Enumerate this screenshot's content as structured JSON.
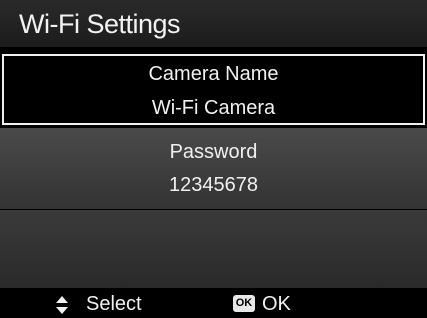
{
  "title": "Wi-Fi Settings",
  "items": [
    {
      "label": "Camera Name",
      "value": "Wi-Fi Camera",
      "selected": true
    },
    {
      "label": "Password",
      "value": "12345678",
      "selected": false
    }
  ],
  "footer": {
    "select_label": "Select",
    "ok_icon_text": "OK",
    "ok_label": "OK"
  },
  "icons": {
    "navigate": "up-down-arrows-icon",
    "confirm": "ok-button-icon"
  }
}
